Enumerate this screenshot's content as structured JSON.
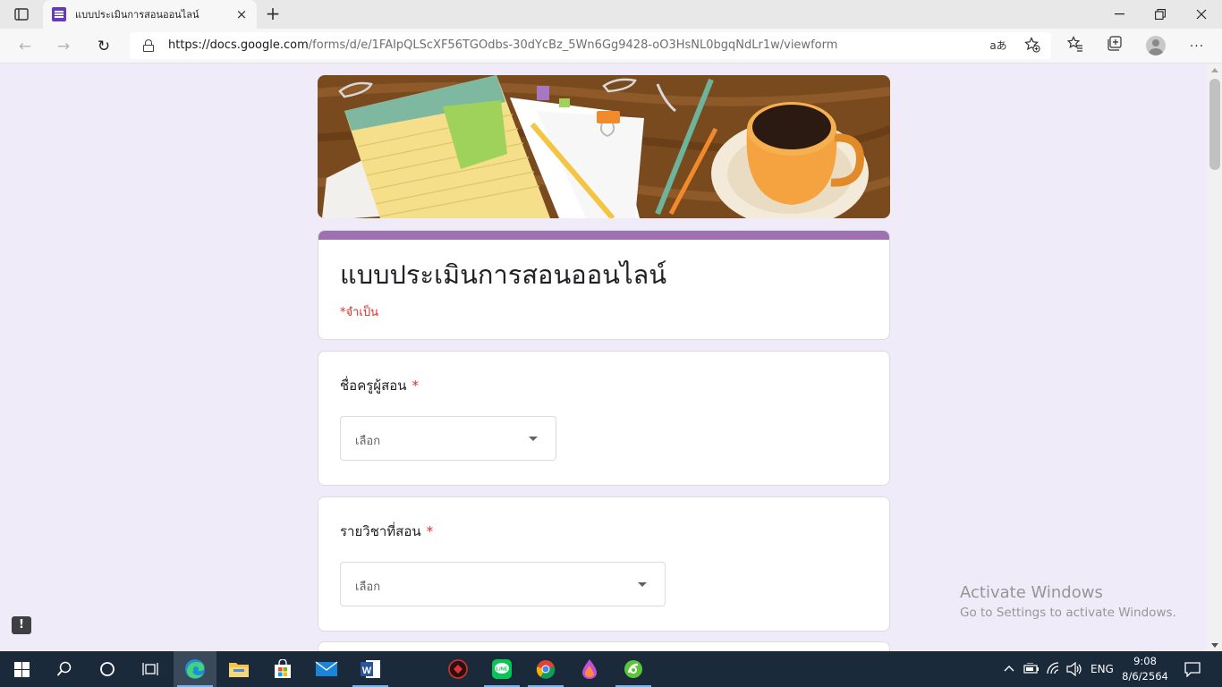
{
  "browser": {
    "tab": {
      "title": "แบบประเมินการสอนออนไลน์",
      "close_label": "×"
    },
    "new_tab_label": "+",
    "window_controls": {
      "minimize": "—",
      "restore": "❐",
      "close": "✕"
    },
    "url": {
      "host": "https://docs.google.com",
      "path": "/forms/d/e/1FAIpQLScXF56TGOdbs-30dYcBz_5Wn6Gg9428-oO3HsNL0bgqNdLr1w/viewform"
    },
    "icons": {
      "back": "←",
      "forward": "→",
      "refresh": "↻",
      "read_aloud": "ꞏ",
      "favorite_add": "☆",
      "favorites": "☆",
      "collections": "⧉",
      "more": "···"
    },
    "read_aloud_label": "aあ"
  },
  "form": {
    "title": "แบบประเมินการสอนออนไลน์",
    "required_note": "*จำเป็น",
    "accent_color": "#9e72b0",
    "questions": [
      {
        "label": "ชื่อครูผู้สอน",
        "required_mark": "*",
        "placeholder": "เลือก"
      },
      {
        "label": "รายวิชาที่สอน",
        "required_mark": "*",
        "placeholder": "เลือก"
      }
    ]
  },
  "report_button": "!",
  "watermark": {
    "heading": "Activate Windows",
    "subtext": "Go to Settings to activate Windows."
  },
  "taskbar": {
    "language": "ENG",
    "time": "9:08",
    "date": "8/6/2564"
  }
}
